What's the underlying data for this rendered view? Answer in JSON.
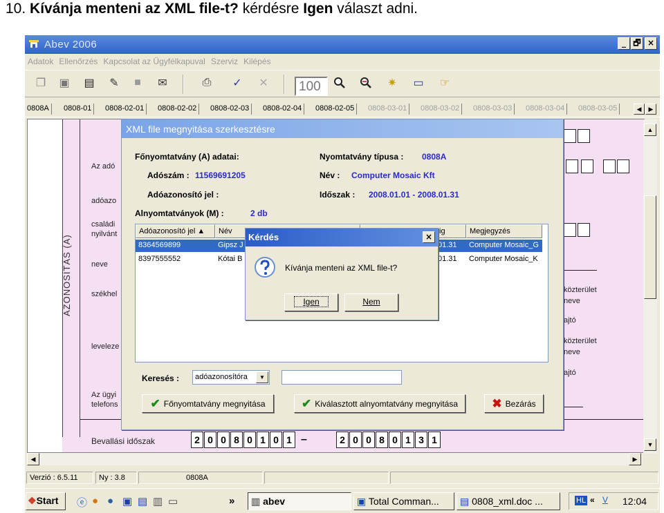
{
  "caption": {
    "number": "10.",
    "bold_part": "Kívánja menteni az XML file-t?",
    "middle": " kérdésre ",
    "bold_answer": "Igen",
    "tail": " választ adni."
  },
  "app": {
    "title": "Abev 2006",
    "minimize": "_",
    "maximize": "🗗",
    "close": "×"
  },
  "menu": [
    "Adatok",
    "Ellenőrzés",
    "Kapcsolat az Ügyfélkapuval",
    "Szerviz",
    "Kilépés"
  ],
  "toolbar": {
    "zoom_value": "100"
  },
  "tabs": {
    "first": "0808A",
    "items": [
      "0808-01",
      "0808-02-01",
      "0808-02-02",
      "0808-02-03",
      "0808-02-04",
      "0808-02-05"
    ],
    "dim_items": [
      "0808-03-01",
      "0808-03-02",
      "0808-03-03",
      "0808-03-04",
      "0808-03-05"
    ]
  },
  "form": {
    "vertical_label": "AZONOSITÁS (A)",
    "labels": [
      "Az adó",
      "adóazo",
      "családi",
      "nyilvánt",
      "neve",
      "székhel",
      "leveleze",
      "Az ügyi",
      "telefons"
    ],
    "right_labels": [
      "közterület",
      "neve",
      "ajtó",
      "közterület",
      "neve",
      "ajtó"
    ],
    "period_label": "Bevallási időszak",
    "period_from_digits": [
      "2",
      "0",
      "0",
      "8",
      "0",
      "1",
      "0",
      "1"
    ],
    "period_dash": "–",
    "period_to_digits": [
      "2",
      "0",
      "0",
      "8",
      "0",
      "1",
      "3",
      "1"
    ]
  },
  "status": {
    "version": "Verzió : 6.5.11",
    "ny": "Ny : 3.8",
    "form": "0808A"
  },
  "taskbar": {
    "start": "Start",
    "chevron": "»",
    "tasks": [
      "abev",
      "Total Comman...",
      "0808_xml.doc ..."
    ],
    "tray_chevron": "«",
    "clock": "12:04"
  },
  "dialog": {
    "title": "XML file megnyitása szerkesztésre",
    "main_heading": "Főnyomtatvány (A) adatai:",
    "adoszam_key": "Adószám :",
    "adoszam_value": "11569691205",
    "adoazon_key": "Adóazonosító jel :",
    "type_key": "Nyomtatvány típusa :",
    "type_value": "0808A",
    "name_key": "Név :",
    "name_value": "Computer Mosaic Kft",
    "period_key": "Időszak :",
    "period_value": "2008.01.01 - 2008.01.31",
    "sub_key": "Alnyomtatványok (M) :",
    "sub_value": "2 db",
    "columns": {
      "adoazon": "Adóazonosító jel ▲",
      "nev": "Név",
      "ig": "ig",
      "megj": "Megjegyzés"
    },
    "rows": [
      {
        "id": "8364569899",
        "name": "Gipsz J",
        "date": "01.31",
        "note": "Computer Mosaic_G"
      },
      {
        "id": "8397555552",
        "name": "Kótai B",
        "date": "01.31",
        "note": "Computer Mosaic_K"
      }
    ],
    "search_label": "Keresés :",
    "search_combo": "adóazonosítóra",
    "search_value": "",
    "btn_main": "Főnyomtatvány megnyitása",
    "btn_selected": "Kiválasztott alnyomtatvány megnyitása",
    "btn_close": "Bezárás"
  },
  "question": {
    "title": "Kérdés",
    "close": "×",
    "text": "Kívánja menteni az XML file-t?",
    "yes": "Igen",
    "no": "Nem"
  }
}
